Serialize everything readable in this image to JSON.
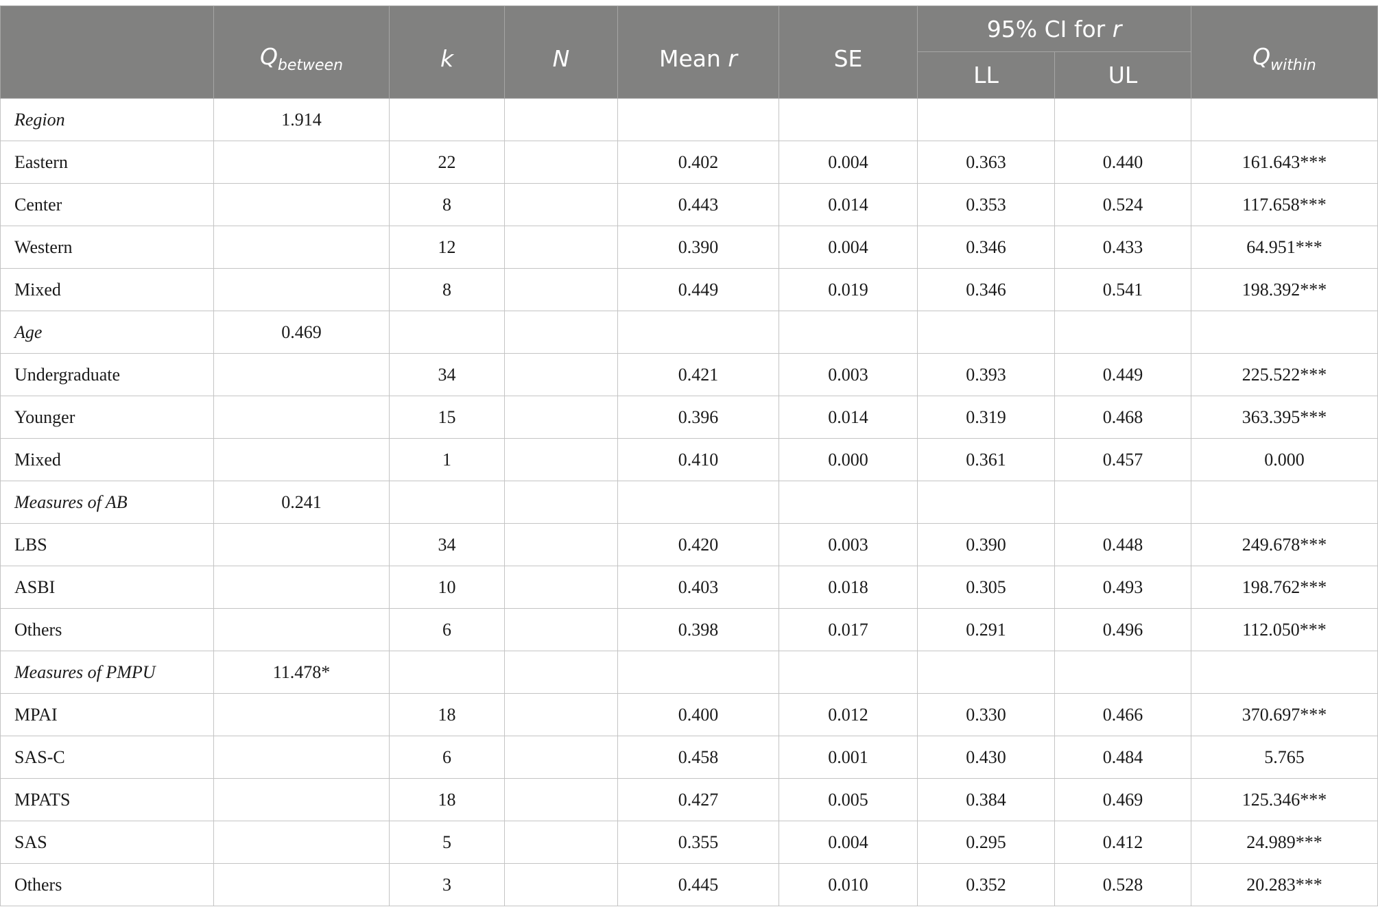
{
  "header": {
    "col_label_blank": "",
    "q_between": {
      "main": "Q",
      "sub": "between"
    },
    "k": "k",
    "n": "N",
    "mean_r": {
      "text": "Mean ",
      "italic": "r"
    },
    "se": "SE",
    "ci": {
      "text": "95% CI for ",
      "italic": "r"
    },
    "ll": "LL",
    "ul": "UL",
    "q_within": {
      "main": "Q",
      "sub": "within"
    }
  },
  "rows": [
    {
      "type": "group",
      "label": "Region",
      "q_between": "1.914",
      "k": "",
      "n": "",
      "mean_r": "",
      "se": "",
      "ll": "",
      "ul": "",
      "q_within": ""
    },
    {
      "type": "item",
      "label": "Eastern",
      "q_between": "",
      "k": "22",
      "n": "",
      "mean_r": "0.402",
      "se": "0.004",
      "ll": "0.363",
      "ul": "0.440",
      "q_within": "161.643***"
    },
    {
      "type": "item",
      "label": "Center",
      "q_between": "",
      "k": "8",
      "n": "",
      "mean_r": "0.443",
      "se": "0.014",
      "ll": "0.353",
      "ul": "0.524",
      "q_within": "117.658***"
    },
    {
      "type": "item",
      "label": "Western",
      "q_between": "",
      "k": "12",
      "n": "",
      "mean_r": "0.390",
      "se": "0.004",
      "ll": "0.346",
      "ul": "0.433",
      "q_within": "64.951***"
    },
    {
      "type": "item",
      "label": "Mixed",
      "q_between": "",
      "k": "8",
      "n": "",
      "mean_r": "0.449",
      "se": "0.019",
      "ll": "0.346",
      "ul": "0.541",
      "q_within": "198.392***"
    },
    {
      "type": "group",
      "label": "Age",
      "q_between": "0.469",
      "k": "",
      "n": "",
      "mean_r": "",
      "se": "",
      "ll": "",
      "ul": "",
      "q_within": ""
    },
    {
      "type": "item",
      "label": "Undergraduate",
      "q_between": "",
      "k": "34",
      "n": "",
      "mean_r": "0.421",
      "se": "0.003",
      "ll": "0.393",
      "ul": "0.449",
      "q_within": "225.522***"
    },
    {
      "type": "item",
      "label": "Younger",
      "q_between": "",
      "k": "15",
      "n": "",
      "mean_r": "0.396",
      "se": "0.014",
      "ll": "0.319",
      "ul": "0.468",
      "q_within": "363.395***"
    },
    {
      "type": "item",
      "label": "Mixed",
      "q_between": "",
      "k": "1",
      "n": "",
      "mean_r": "0.410",
      "se": "0.000",
      "ll": "0.361",
      "ul": "0.457",
      "q_within": "0.000"
    },
    {
      "type": "group",
      "label": "Measures of AB",
      "q_between": "0.241",
      "k": "",
      "n": "",
      "mean_r": "",
      "se": "",
      "ll": "",
      "ul": "",
      "q_within": ""
    },
    {
      "type": "item",
      "label": "LBS",
      "q_between": "",
      "k": "34",
      "n": "",
      "mean_r": "0.420",
      "se": "0.003",
      "ll": "0.390",
      "ul": "0.448",
      "q_within": "249.678***"
    },
    {
      "type": "item",
      "label": "ASBI",
      "q_between": "",
      "k": "10",
      "n": "",
      "mean_r": "0.403",
      "se": "0.018",
      "ll": "0.305",
      "ul": "0.493",
      "q_within": "198.762***"
    },
    {
      "type": "item",
      "label": "Others",
      "q_between": "",
      "k": "6",
      "n": "",
      "mean_r": "0.398",
      "se": "0.017",
      "ll": "0.291",
      "ul": "0.496",
      "q_within": "112.050***"
    },
    {
      "type": "group",
      "label": "Measures of PMPU",
      "q_between": "11.478*",
      "k": "",
      "n": "",
      "mean_r": "",
      "se": "",
      "ll": "",
      "ul": "",
      "q_within": ""
    },
    {
      "type": "item",
      "label": "MPAI",
      "q_between": "",
      "k": "18",
      "n": "",
      "mean_r": "0.400",
      "se": "0.012",
      "ll": "0.330",
      "ul": "0.466",
      "q_within": "370.697***"
    },
    {
      "type": "item",
      "label": "SAS-C",
      "q_between": "",
      "k": "6",
      "n": "",
      "mean_r": "0.458",
      "se": "0.001",
      "ll": "0.430",
      "ul": "0.484",
      "q_within": "5.765"
    },
    {
      "type": "item",
      "label": "MPATS",
      "q_between": "",
      "k": "18",
      "n": "",
      "mean_r": "0.427",
      "se": "0.005",
      "ll": "0.384",
      "ul": "0.469",
      "q_within": "125.346***"
    },
    {
      "type": "item",
      "label": "SAS",
      "q_between": "",
      "k": "5",
      "n": "",
      "mean_r": "0.355",
      "se": "0.004",
      "ll": "0.295",
      "ul": "0.412",
      "q_within": "24.989***"
    },
    {
      "type": "item",
      "label": "Others",
      "q_between": "",
      "k": "3",
      "n": "",
      "mean_r": "0.445",
      "se": "0.010",
      "ll": "0.352",
      "ul": "0.528",
      "q_within": "20.283***"
    }
  ]
}
